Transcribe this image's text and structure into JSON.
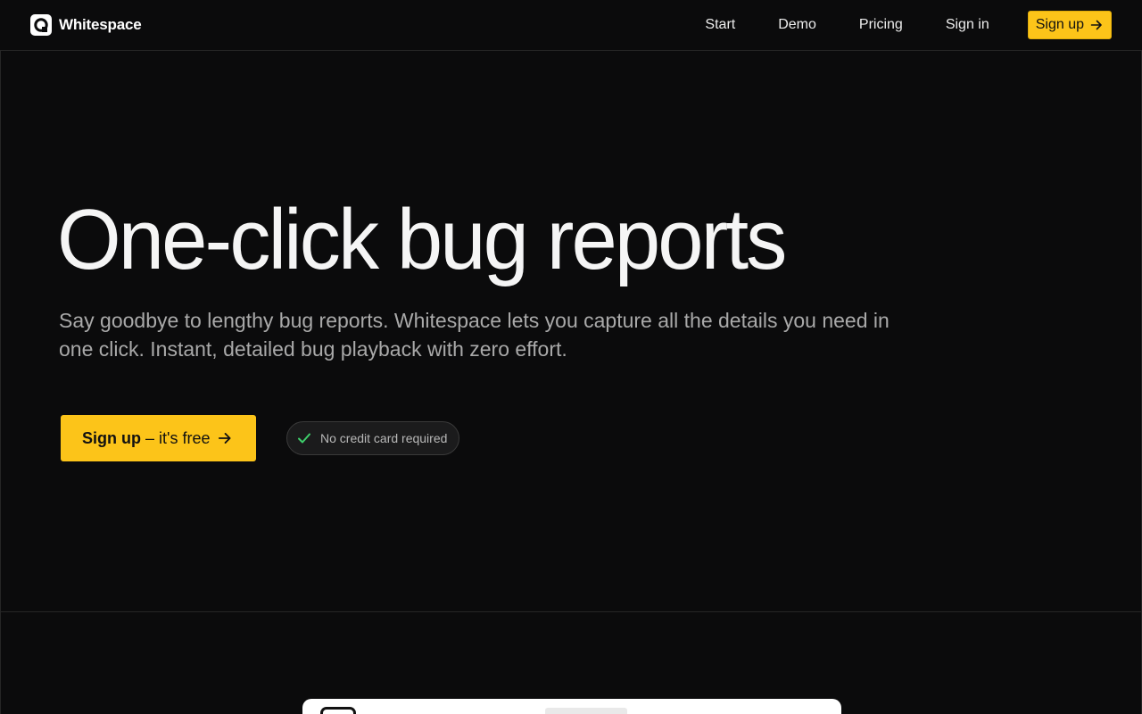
{
  "header": {
    "brand": "Whitespace",
    "nav": [
      "Start",
      "Demo",
      "Pricing",
      "Sign in"
    ],
    "cta_label": "Sign up"
  },
  "hero": {
    "title": "One-click bug reports",
    "subtitle": "Say goodbye to lengthy bug reports. Whitespace lets you capture all the details you need in one click. Instant, detailed bug playback with zero effort.",
    "cta_strong": "Sign up",
    "cta_rest": " – it's free",
    "badge": "No credit card required"
  },
  "icons": {
    "logo": "whitespace-logo",
    "arrow": "arrow-right-icon",
    "check": "check-icon"
  },
  "colors": {
    "accent": "#fcc419",
    "background": "#0b0b0c",
    "check": "#3ecf6b"
  }
}
